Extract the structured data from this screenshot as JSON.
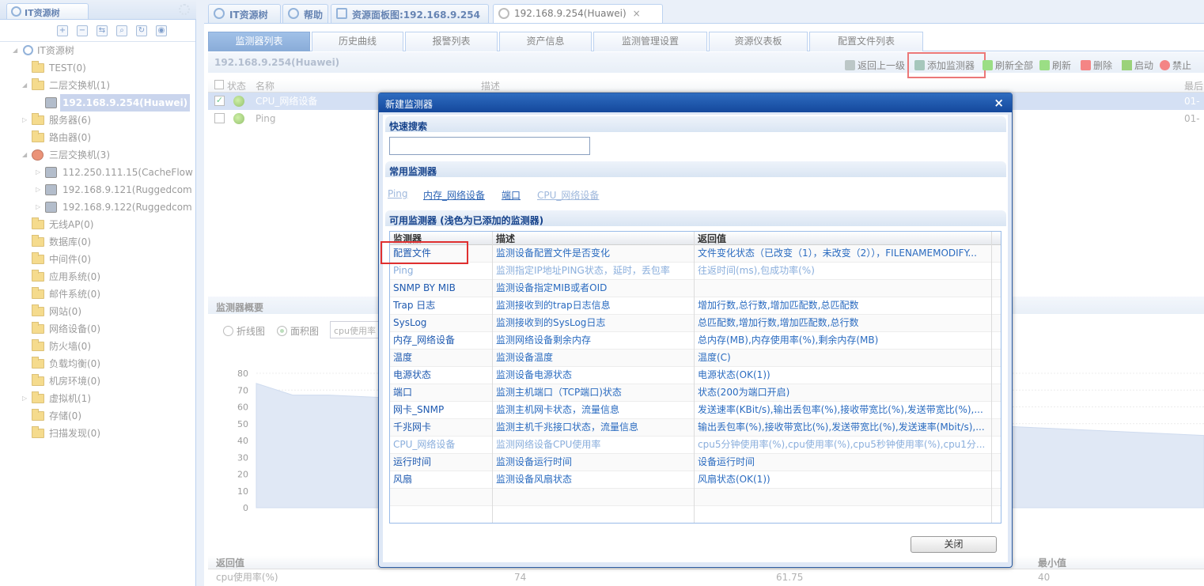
{
  "left": {
    "tab": "IT资源树",
    "root": "IT资源树",
    "nodes": [
      {
        "label": "TEST(0)",
        "kind": "folder",
        "indent": 1
      },
      {
        "label": "二层交换机(1)",
        "kind": "folder",
        "indent": 1,
        "open": true
      },
      {
        "label": "192.168.9.254(Huawei)",
        "kind": "device",
        "indent": 2,
        "selected": true
      },
      {
        "label": "服务器(6)",
        "kind": "folder",
        "indent": 1,
        "arrow": true
      },
      {
        "label": "路由器(0)",
        "kind": "folder",
        "indent": 1
      },
      {
        "label": "三层交换机(3)",
        "kind": "alert",
        "indent": 1,
        "open": true
      },
      {
        "label": "112.250.111.15(CacheFlow",
        "kind": "device",
        "indent": 2,
        "arrow": true
      },
      {
        "label": "192.168.9.121(Ruggedcom",
        "kind": "device",
        "indent": 2,
        "arrow": true
      },
      {
        "label": "192.168.9.122(Ruggedcom",
        "kind": "device",
        "indent": 2,
        "arrow": true
      },
      {
        "label": "无线AP(0)",
        "kind": "folder",
        "indent": 1
      },
      {
        "label": "数据库(0)",
        "kind": "folder",
        "indent": 1
      },
      {
        "label": "中间件(0)",
        "kind": "folder",
        "indent": 1
      },
      {
        "label": "应用系统(0)",
        "kind": "folder",
        "indent": 1
      },
      {
        "label": "邮件系统(0)",
        "kind": "folder",
        "indent": 1
      },
      {
        "label": "网站(0)",
        "kind": "folder",
        "indent": 1
      },
      {
        "label": "网络设备(0)",
        "kind": "folder",
        "indent": 1
      },
      {
        "label": "防火墙(0)",
        "kind": "folder",
        "indent": 1
      },
      {
        "label": "负载均衡(0)",
        "kind": "folder",
        "indent": 1
      },
      {
        "label": "机房环境(0)",
        "kind": "folder",
        "indent": 1
      },
      {
        "label": "虚拟机(1)",
        "kind": "folder",
        "indent": 1,
        "arrow": true
      },
      {
        "label": "存储(0)",
        "kind": "folder",
        "indent": 1
      },
      {
        "label": "扫描发现(0)",
        "kind": "folder",
        "indent": 1
      }
    ]
  },
  "toptabs": [
    "IT资源树",
    "帮助",
    "资源面板图:192.168.9.254",
    "192.168.9.254(Huawei)"
  ],
  "close_x": "×",
  "subtabs": [
    "监测器列表",
    "历史曲线",
    "报警列表",
    "资产信息",
    "监测管理设置",
    "资源仪表板",
    "配置文件列表"
  ],
  "detail_title": "192.168.9.254(Huawei)",
  "toolbar": {
    "back": "返回上一级",
    "add": "添加监测器",
    "refresh_all": "刷新全部",
    "refresh": "刷新",
    "delete": "删除",
    "start": "启动",
    "stop": "禁止"
  },
  "grid": {
    "h_status": "状态",
    "h_name": "名称",
    "h_desc": "描述",
    "h_last": "最后",
    "rows": [
      {
        "name": "CPU_网络设备",
        "time": "01-"
      },
      {
        "name": "Ping",
        "time": "01-"
      }
    ]
  },
  "summary": {
    "title": "监测器概要",
    "r1": "折线图",
    "r2": "面积图",
    "select": "cpu使用率"
  },
  "chart_data": {
    "type": "area",
    "yticks": [
      "80",
      "70",
      "60",
      "50",
      "40",
      "30",
      "20",
      "10",
      "0"
    ],
    "ylim": [
      0,
      80
    ],
    "series": [
      {
        "values": [
          74,
          67,
          67,
          66,
          65,
          64,
          63,
          62,
          61,
          60,
          59,
          58,
          57,
          56,
          55,
          54,
          53,
          52,
          51,
          50,
          49,
          48,
          47,
          46,
          45,
          44,
          43
        ]
      }
    ]
  },
  "bottom": {
    "h1": "返回值",
    "h2": "",
    "h3": "",
    "h4": "最小值",
    "v1": "cpu使用率(%)",
    "v2": "74",
    "v3": "61.75",
    "v4": "40"
  },
  "modal": {
    "title": "新建监测器",
    "close": "×",
    "quick": "快速搜索",
    "common": "常用监测器",
    "links": [
      {
        "label": "Ping",
        "light": true
      },
      {
        "label": "内存_网络设备",
        "light": false
      },
      {
        "label": "端口",
        "light": false
      },
      {
        "label": "CPU_网络设备",
        "light": true
      }
    ],
    "available": "可用监测器 (浅色为已添加的监测器)",
    "cols": [
      "监测器",
      "描述",
      "返回值"
    ],
    "rows": [
      {
        "name": "配置文件",
        "desc": "监测设备配置文件是否变化",
        "ret": "文件变化状态（已改变（1），未改变（2）），FILENAMEMODIFY..."
      },
      {
        "name": "Ping",
        "desc": "监测指定IP地址PING状态，延时，丢包率",
        "ret": "往返时间(ms),包成功率(%)",
        "light": true
      },
      {
        "name": "SNMP BY MIB",
        "desc": "监测设备指定MIB或者OID",
        "ret": ""
      },
      {
        "name": "Trap 日志",
        "desc": "监测接收到的trap日志信息",
        "ret": "增加行数,总行数,增加匹配数,总匹配数"
      },
      {
        "name": "SysLog",
        "desc": "监测接收到的SysLog日志",
        "ret": "总匹配数,增加行数,增加匹配数,总行数"
      },
      {
        "name": "内存_网络设备",
        "desc": "监测网络设备剩余内存",
        "ret": "总内存(MB),内存使用率(%),剩余内存(MB)"
      },
      {
        "name": "温度",
        "desc": "监测设备温度",
        "ret": "温度(C)"
      },
      {
        "name": "电源状态",
        "desc": "监测设备电源状态",
        "ret": "电源状态(OK(1))"
      },
      {
        "name": "端口",
        "desc": "监测主机端口（TCP端口)状态",
        "ret": "状态(200为端口开启)"
      },
      {
        "name": "网卡_SNMP",
        "desc": "监测主机网卡状态，流量信息",
        "ret": "发送速率(KBit/s),输出丢包率(%),接收带宽比(%),发送带宽比(%),..."
      },
      {
        "name": "千兆网卡",
        "desc": "监测主机千兆接口状态，流量信息",
        "ret": "输出丢包率(%),接收带宽比(%),发送带宽比(%),发送速率(Mbit/s),..."
      },
      {
        "name": "CPU_网络设备",
        "desc": "监测网络设备CPU使用率",
        "ret": "cpu5分钟使用率(%),cpu使用率(%),cpu5秒钟使用率(%),cpu1分...",
        "light": true
      },
      {
        "name": "运行时间",
        "desc": "监测设备运行时间",
        "ret": "设备运行时间"
      },
      {
        "name": "风扇",
        "desc": "监测设备风扇状态",
        "ret": "风扇状态(OK(1))"
      }
    ],
    "btn": "关闭"
  }
}
